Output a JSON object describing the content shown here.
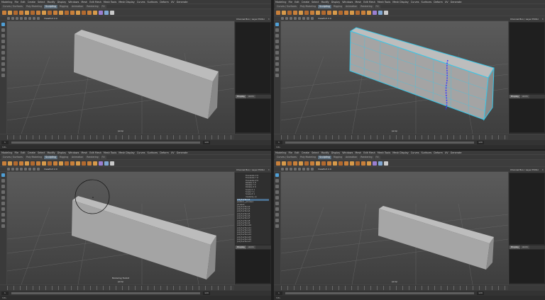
{
  "menu": {
    "items": [
      "Modeling",
      "File",
      "Edit",
      "Create",
      "Select",
      "Modify",
      "Display",
      "Windows",
      "Mesh",
      "Edit Mesh",
      "Mesh Tools",
      "Mesh Display",
      "Curves",
      "Surfaces",
      "Deform",
      "UV",
      "Generate",
      "Cache",
      "Arnold",
      "Help"
    ]
  },
  "shelf": {
    "tabs": [
      "Curves / Surfaces",
      "Poly Modeling",
      "Sculpting",
      "Rigging",
      "Animation",
      "Rendering",
      "FX",
      "FX Caching",
      "Custom",
      "Arnold",
      "Bifrost"
    ],
    "active_tab": "Sculpting",
    "icon_colors": [
      "#c9803a",
      "#d79a4a",
      "#b26a2f",
      "#c9803a",
      "#d79a4a",
      "#b26a2f",
      "#c9803a",
      "#d79a4a",
      "#b26a2f",
      "#c9803a",
      "#d79a4a",
      "#b26a2f",
      "#c9803a",
      "#d79a4a",
      "#b26a2f",
      "#c9803a",
      "#d79a4a",
      "#9a7fd1",
      "#7fa6d1",
      "#c9c9c9"
    ]
  },
  "viewport": {
    "renderer": "ViewPort 2.0",
    "camera": "persp"
  },
  "panes": [
    {
      "side_title": "Channel Box / Layer Editor",
      "side_tabs": [
        "Display",
        "Anim"
      ],
      "hud": ""
    },
    {
      "side_title": "Channel Box / Layer Editor",
      "side_tabs": [
        "Display",
        "Anim"
      ],
      "hud": ""
    },
    {
      "side_title": "Channel Box / Layer Editor",
      "side_tabs": [
        "Display",
        "Anim"
      ],
      "hud": "Modeling Toolkit",
      "outliner": [
        "polySurface1",
        "pasted__pCube1",
        "pCube1",
        "polySurface2",
        "polySurface3",
        "polySurface4",
        "polySurface5",
        "polySurface6",
        "polySurface7",
        "polySurface8",
        "polySurface9",
        "polySurface10",
        "polySurface11",
        "polySurface12",
        "polySurface13",
        "polySurface14",
        "polySurface15",
        "polySurface16",
        "polySurface17"
      ],
      "attrs": [
        "Translate X 0",
        "Translate Y 0",
        "Translate Z 0",
        "Rotate X 0",
        "Rotate Y 0",
        "Rotate Z 0",
        "Scale X 1",
        "Scale Y 1",
        "Scale Z 1",
        "Visibility on"
      ]
    },
    {
      "side_title": "Channel Box / Layer Editor",
      "side_tabs": [
        "Display",
        "Anim"
      ],
      "hud": ""
    }
  ],
  "timeline": {
    "start": "1",
    "end": "120",
    "current": "1",
    "fps": "24 fps",
    "char_set": "No Character Set",
    "anim_layer": "No Anim Layer"
  },
  "command_line": "MEL",
  "help_line": "Select Tool: select an object"
}
